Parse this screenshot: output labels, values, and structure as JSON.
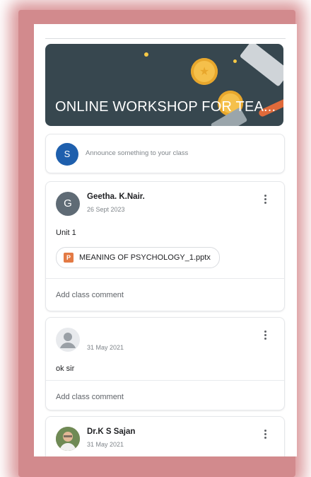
{
  "class": {
    "banner_title": "ONLINE WORKSHOP FOR TEA...",
    "announce_avatar": "S",
    "announce_placeholder": "Announce something to your class"
  },
  "posts": [
    {
      "avatar_letter": "G",
      "author": "Geetha. K.Nair.",
      "date": "26 Sept 2023",
      "text": "Unit 1",
      "attachment": {
        "icon": "P",
        "name": "MEANING OF PSYCHOLOGY_1.pptx"
      },
      "comment_placeholder": "Add class comment"
    },
    {
      "avatar_letter": "",
      "author": "",
      "date": "31 May 2021",
      "text": "ok sir",
      "comment_placeholder": "Add class comment"
    },
    {
      "author": "Dr.K S Sajan",
      "date": "31 May 2021"
    }
  ],
  "colors": {
    "banner_bg": "#37474f",
    "avatar_s": "#1e5fad",
    "avatar_g": "#5f6b75",
    "frame_glow": "#d28a8d",
    "ppt_orange": "#e37a44"
  }
}
